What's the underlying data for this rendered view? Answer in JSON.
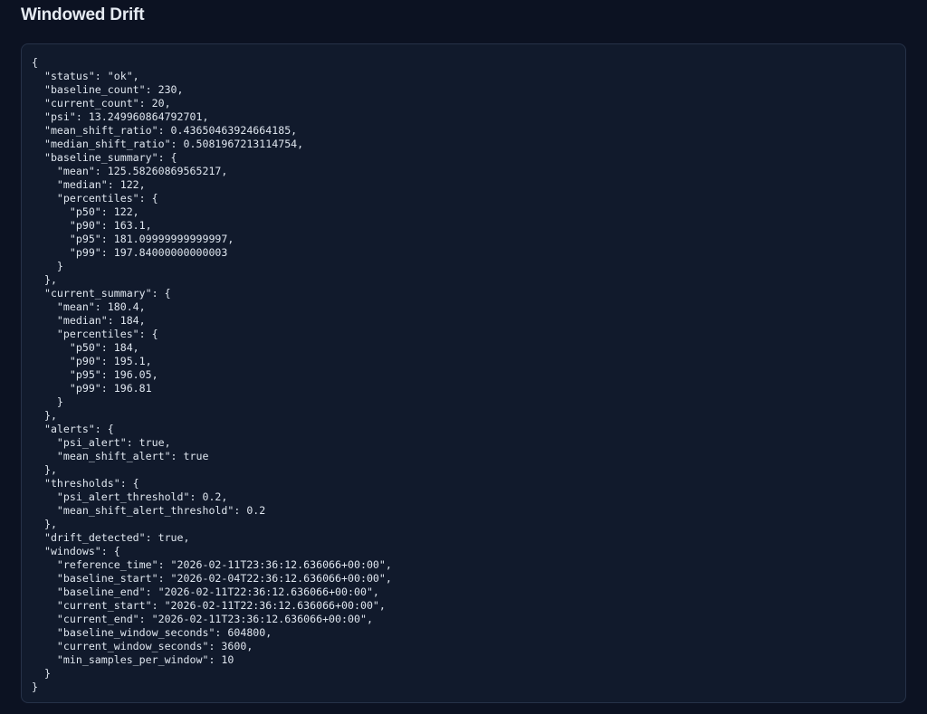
{
  "page": {
    "title": "Windowed Drift"
  },
  "json_view": {
    "text": "{\n  \"status\": \"ok\",\n  \"baseline_count\": 230,\n  \"current_count\": 20,\n  \"psi\": 13.249960864792701,\n  \"mean_shift_ratio\": 0.43650463924664185,\n  \"median_shift_ratio\": 0.5081967213114754,\n  \"baseline_summary\": {\n    \"mean\": 125.58260869565217,\n    \"median\": 122,\n    \"percentiles\": {\n      \"p50\": 122,\n      \"p90\": 163.1,\n      \"p95\": 181.09999999999997,\n      \"p99\": 197.84000000000003\n    }\n  },\n  \"current_summary\": {\n    \"mean\": 180.4,\n    \"median\": 184,\n    \"percentiles\": {\n      \"p50\": 184,\n      \"p90\": 195.1,\n      \"p95\": 196.05,\n      \"p99\": 196.81\n    }\n  },\n  \"alerts\": {\n    \"psi_alert\": true,\n    \"mean_shift_alert\": true\n  },\n  \"thresholds\": {\n    \"psi_alert_threshold\": 0.2,\n    \"mean_shift_alert_threshold\": 0.2\n  },\n  \"drift_detected\": true,\n  \"windows\": {\n    \"reference_time\": \"2026-02-11T23:36:12.636066+00:00\",\n    \"baseline_start\": \"2026-02-04T22:36:12.636066+00:00\",\n    \"baseline_end\": \"2026-02-11T22:36:12.636066+00:00\",\n    \"current_start\": \"2026-02-11T22:36:12.636066+00:00\",\n    \"current_end\": \"2026-02-11T23:36:12.636066+00:00\",\n    \"baseline_window_seconds\": 604800,\n    \"current_window_seconds\": 3600,\n    \"min_samples_per_window\": 10\n  }\n}"
  },
  "colors": {
    "page_background": "#0c1222",
    "panel_background": "#111a2c",
    "panel_border": "#263248",
    "text": "#dfe6ef",
    "title_text": "#e6ebf2"
  }
}
